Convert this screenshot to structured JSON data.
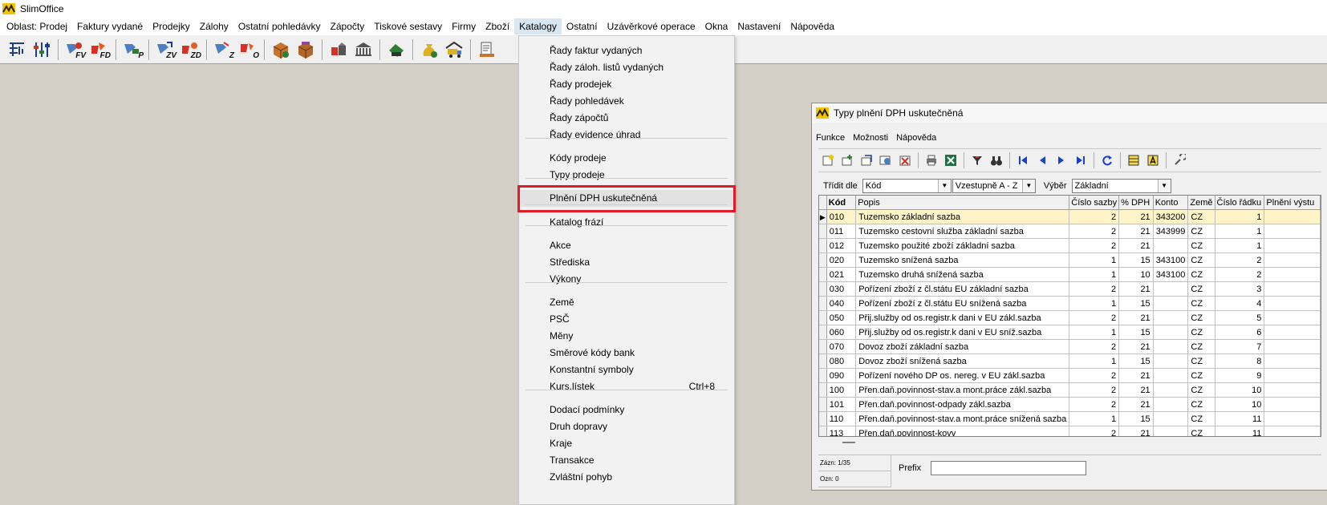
{
  "app": {
    "title": "SlimOffice"
  },
  "menubar": [
    "Oblast: Prodej",
    "Faktury vydané",
    "Prodejky",
    "Zálohy",
    "Ostatní pohledávky",
    "Zápočty",
    "Tiskové sestavy",
    "Firmy",
    "Zboží",
    "Katalogy",
    "Ostatní",
    "Uzávěrkové operace",
    "Okna",
    "Nastavení",
    "Nápověda"
  ],
  "toolbar": {
    "labels": {
      "fv": "FV",
      "fd": "FD",
      "p": "P",
      "zv": "ZV",
      "zd": "ZD",
      "z": "Z",
      "o": "O"
    }
  },
  "catalog_menu": {
    "items": [
      "Řady faktur vydaných",
      "Řady záloh. listů vydaných",
      "Řady prodejek",
      "Řady pohledávek",
      "Řady zápočtů",
      "Řady evidence úhrad",
      "Kódy prodeje",
      "Typy prodeje",
      "Plnění DPH uskutečněná",
      "Katalog frází",
      "Akce",
      "Střediska",
      "Výkony",
      "Země",
      "PSČ",
      "Měny",
      "Směrové kódy bank",
      "Konstantní symboly",
      "Kurs.lístek",
      "Dodací podmínky",
      "Druh dopravy",
      "Kraje",
      "Transakce",
      "Zvláštní pohyb"
    ],
    "shortcut_kurs": "Ctrl+8"
  },
  "window": {
    "title": "Typy plnění DPH uskutečněná",
    "menu": [
      "Funkce",
      "Možnosti",
      "Nápověda"
    ],
    "sort": {
      "label": "Třídit dle",
      "field": "Kód",
      "order": "Vzestupně  A - Z",
      "filter_label": "Výběr",
      "filter": "Základní"
    },
    "columns": [
      "Kód",
      "Popis",
      "Číslo sazby",
      "% DPH",
      "Konto",
      "Země",
      "Číslo řádku",
      "Plnění výstu"
    ],
    "rows": [
      [
        "010",
        "Tuzemsko základní sazba",
        "2",
        "21",
        "343200",
        "CZ",
        "1"
      ],
      [
        "011",
        "Tuzemsko cestovní služba základní sazba",
        "2",
        "21",
        "343999",
        "CZ",
        "1"
      ],
      [
        "012",
        "Tuzemsko použité zboží základní sazba",
        "2",
        "21",
        "",
        "CZ",
        "1"
      ],
      [
        "020",
        "Tuzemsko snížená sazba",
        "1",
        "15",
        "343100",
        "CZ",
        "2"
      ],
      [
        "021",
        "Tuzemsko druhá snížená sazba",
        "1",
        "10",
        "343100",
        "CZ",
        "2"
      ],
      [
        "030",
        "Pořízení zboží z čl.státu EU základní sazba",
        "2",
        "21",
        "",
        "CZ",
        "3"
      ],
      [
        "040",
        "Pořízení zboží z čl.státu EU snížená sazba",
        "1",
        "15",
        "",
        "CZ",
        "4"
      ],
      [
        "050",
        "Přij.služby od os.registr.k dani v EU zákl.sazba",
        "2",
        "21",
        "",
        "CZ",
        "5"
      ],
      [
        "060",
        "Přij.služby od os.registr.k dani v EU sníž.sazba",
        "1",
        "15",
        "",
        "CZ",
        "6"
      ],
      [
        "070",
        "Dovoz zboží základní sazba",
        "2",
        "21",
        "",
        "CZ",
        "7"
      ],
      [
        "080",
        "Dovoz zboží snížená sazba",
        "1",
        "15",
        "",
        "CZ",
        "8"
      ],
      [
        "090",
        "Pořízení nového DP os. nereg. v EU zákl.sazba",
        "2",
        "21",
        "",
        "CZ",
        "9"
      ],
      [
        "100",
        "Přen.daň.povinnost-stav.a mont.práce zákl.sazba",
        "2",
        "21",
        "",
        "CZ",
        "10"
      ],
      [
        "101",
        "Přen.daň.povinnost-odpady zákl.sazba",
        "2",
        "21",
        "",
        "CZ",
        "10"
      ],
      [
        "110",
        "Přen.daň.povinnost-stav.a mont.práce snížená sazba",
        "1",
        "15",
        "",
        "CZ",
        "11"
      ],
      [
        "113",
        "Přen.daň.povinnost-kovy",
        "2",
        "21",
        "",
        "CZ",
        "11"
      ]
    ],
    "status": {
      "records": "Zázn: 1/35",
      "marked": "Ozn: 0"
    },
    "prefix_label": "Prefix",
    "prefix_value": ""
  }
}
